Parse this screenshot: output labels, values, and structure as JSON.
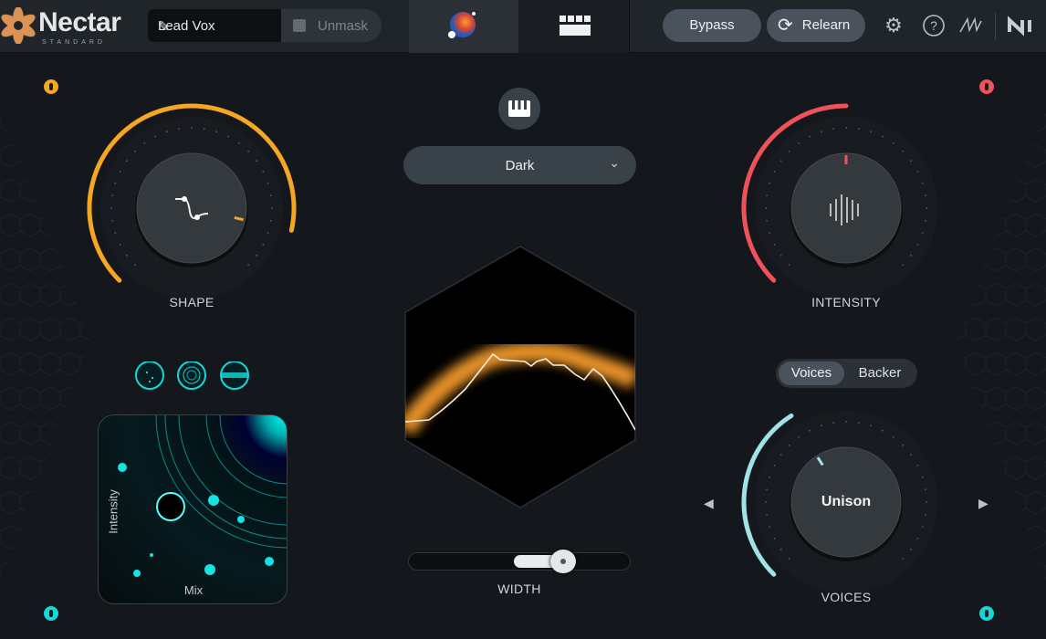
{
  "header": {
    "brand": "Nectar",
    "edition": "STANDARD",
    "preset_name": "Lead Vox",
    "unmask_label": "Unmask",
    "tabs": [
      {
        "name": "visual-mixer",
        "selected": true
      },
      {
        "name": "modules",
        "selected": false
      }
    ],
    "bypass_label": "Bypass",
    "relearn_label": "Relearn",
    "icons": [
      "gear-icon",
      "help-icon",
      "signal-chain-icon",
      "ni-logo"
    ]
  },
  "shape": {
    "label": "SHAPE",
    "value": 0.88,
    "color": "#f5a623"
  },
  "intensity": {
    "label": "INTENSITY",
    "value": 0.5,
    "color": "#f0525c"
  },
  "style": {
    "selected": "Dark",
    "keyboard_icon": "piano-keys-icon"
  },
  "visual": {
    "width_label": "WIDTH",
    "width_value": 0.7
  },
  "voices": {
    "tabs": [
      "Voices",
      "Backer"
    ],
    "selected_tab": "Voices",
    "knob_label": "Unison",
    "label": "VOICES",
    "value": 0.38,
    "color": "#9fe3e8"
  },
  "pad": {
    "x_label": "Mix",
    "y_label": "Intensity",
    "modes": [
      "particles-mode",
      "rings-mode",
      "disc-mode"
    ],
    "accent": "#12d9d9"
  },
  "colors": {
    "orange": "#f5a623",
    "red": "#f0525c",
    "teal": "#12d9d9"
  }
}
